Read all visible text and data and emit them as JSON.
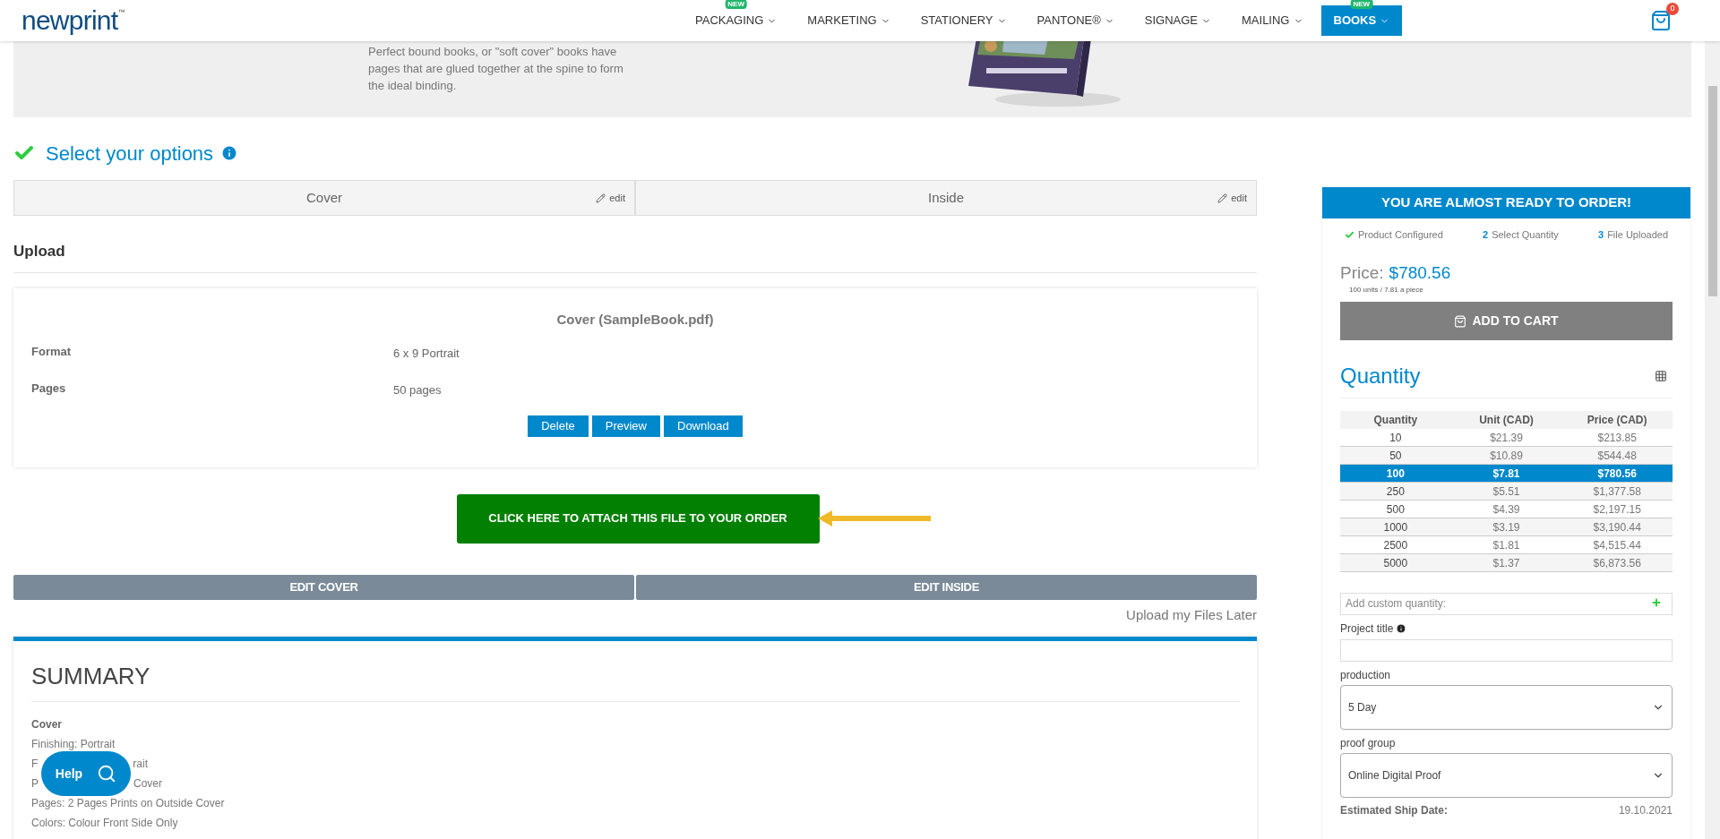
{
  "header": {
    "logo": "newprint",
    "logo_mark": "™",
    "nav": [
      {
        "label": "PACKAGING",
        "badge": "NEW",
        "selected": false
      },
      {
        "label": "MARKETING",
        "selected": false
      },
      {
        "label": "STATIONERY",
        "selected": false
      },
      {
        "label": "PANTONE®",
        "selected": false
      },
      {
        "label": "SIGNAGE",
        "selected": false
      },
      {
        "label": "MAILING",
        "selected": false
      },
      {
        "label": "BOOKS",
        "badge": "NEW",
        "selected": true
      }
    ],
    "cart_count": "0"
  },
  "banner": {
    "text": "Perfect bound books, or \"soft cover\" books have pages that are glued together at the spine to form the ideal binding."
  },
  "options": {
    "title": "Select your options",
    "tabs": [
      {
        "label": "Cover",
        "action": "edit"
      },
      {
        "label": "Inside",
        "action": "edit"
      }
    ]
  },
  "upload": {
    "title": "Upload",
    "file_title": "Cover (SampleBook.pdf)",
    "rows": [
      {
        "label": "Format",
        "value": "6 x 9 Portrait"
      },
      {
        "label": "Pages",
        "value": "50 pages"
      }
    ],
    "buttons": [
      "Delete",
      "Preview",
      "Download"
    ],
    "attach_button": "CLICK HERE TO ATTACH THIS FILE TO YOUR ORDER",
    "edit_buttons": [
      "EDIT COVER",
      "EDIT INSIDE"
    ],
    "later_link": "Upload my Files Later"
  },
  "summary": {
    "title": "SUMMARY",
    "heading": "Cover",
    "lines": [
      {
        "parts": [
          "Finishing: Portrait"
        ]
      },
      {
        "parts": [
          "F",
          "rait"
        ]
      },
      {
        "parts": [
          "P",
          "Cover"
        ]
      },
      {
        "parts": [
          "Pages: 2 Pages Prints on Outside Cover"
        ]
      },
      {
        "parts": [
          "Colors: Colour Front Side Only"
        ]
      }
    ]
  },
  "help_button": "Help",
  "order_panel": {
    "title": "YOU ARE ALMOST READY TO ORDER!",
    "steps": [
      {
        "label": "Product Configured",
        "done": true
      },
      {
        "number": "2",
        "label": "Select Quantity",
        "done": false
      },
      {
        "number": "3",
        "label": "File Uploaded",
        "done": false
      }
    ],
    "price_label": "Price:",
    "price": "$780.56",
    "price_note": "100 units / 7.81 a piece",
    "add_to_cart": "ADD TO CART",
    "quantity_title": "Quantity",
    "table": {
      "columns": [
        "Quantity",
        "Unit (CAD)",
        "Price (CAD)"
      ],
      "rows": [
        {
          "cells": [
            "10",
            "$21.39",
            "$213.85"
          ],
          "selected": false
        },
        {
          "cells": [
            "50",
            "$10.89",
            "$544.48"
          ],
          "selected": false
        },
        {
          "cells": [
            "100",
            "$7.81",
            "$780.56"
          ],
          "selected": true
        },
        {
          "cells": [
            "250",
            "$5.51",
            "$1,377.58"
          ],
          "selected": false
        },
        {
          "cells": [
            "500",
            "$4.39",
            "$2,197.15"
          ],
          "selected": false
        },
        {
          "cells": [
            "1000",
            "$3.19",
            "$3,190.44"
          ],
          "selected": false
        },
        {
          "cells": [
            "2500",
            "$1.81",
            "$4,515.44"
          ],
          "selected": false
        },
        {
          "cells": [
            "5000",
            "$1.37",
            "$6,873.56"
          ],
          "selected": false
        }
      ]
    },
    "custom_quantity": {
      "placeholder": "Add custom quantity:"
    },
    "project_title": {
      "label": "Project title"
    },
    "production": {
      "label": "production",
      "value": "5 Day"
    },
    "proof_group": {
      "label": "proof group",
      "value": "Online Digital Proof"
    },
    "ship_date": {
      "label": "Estimated Ship Date:",
      "value": "19.10.2021"
    }
  }
}
